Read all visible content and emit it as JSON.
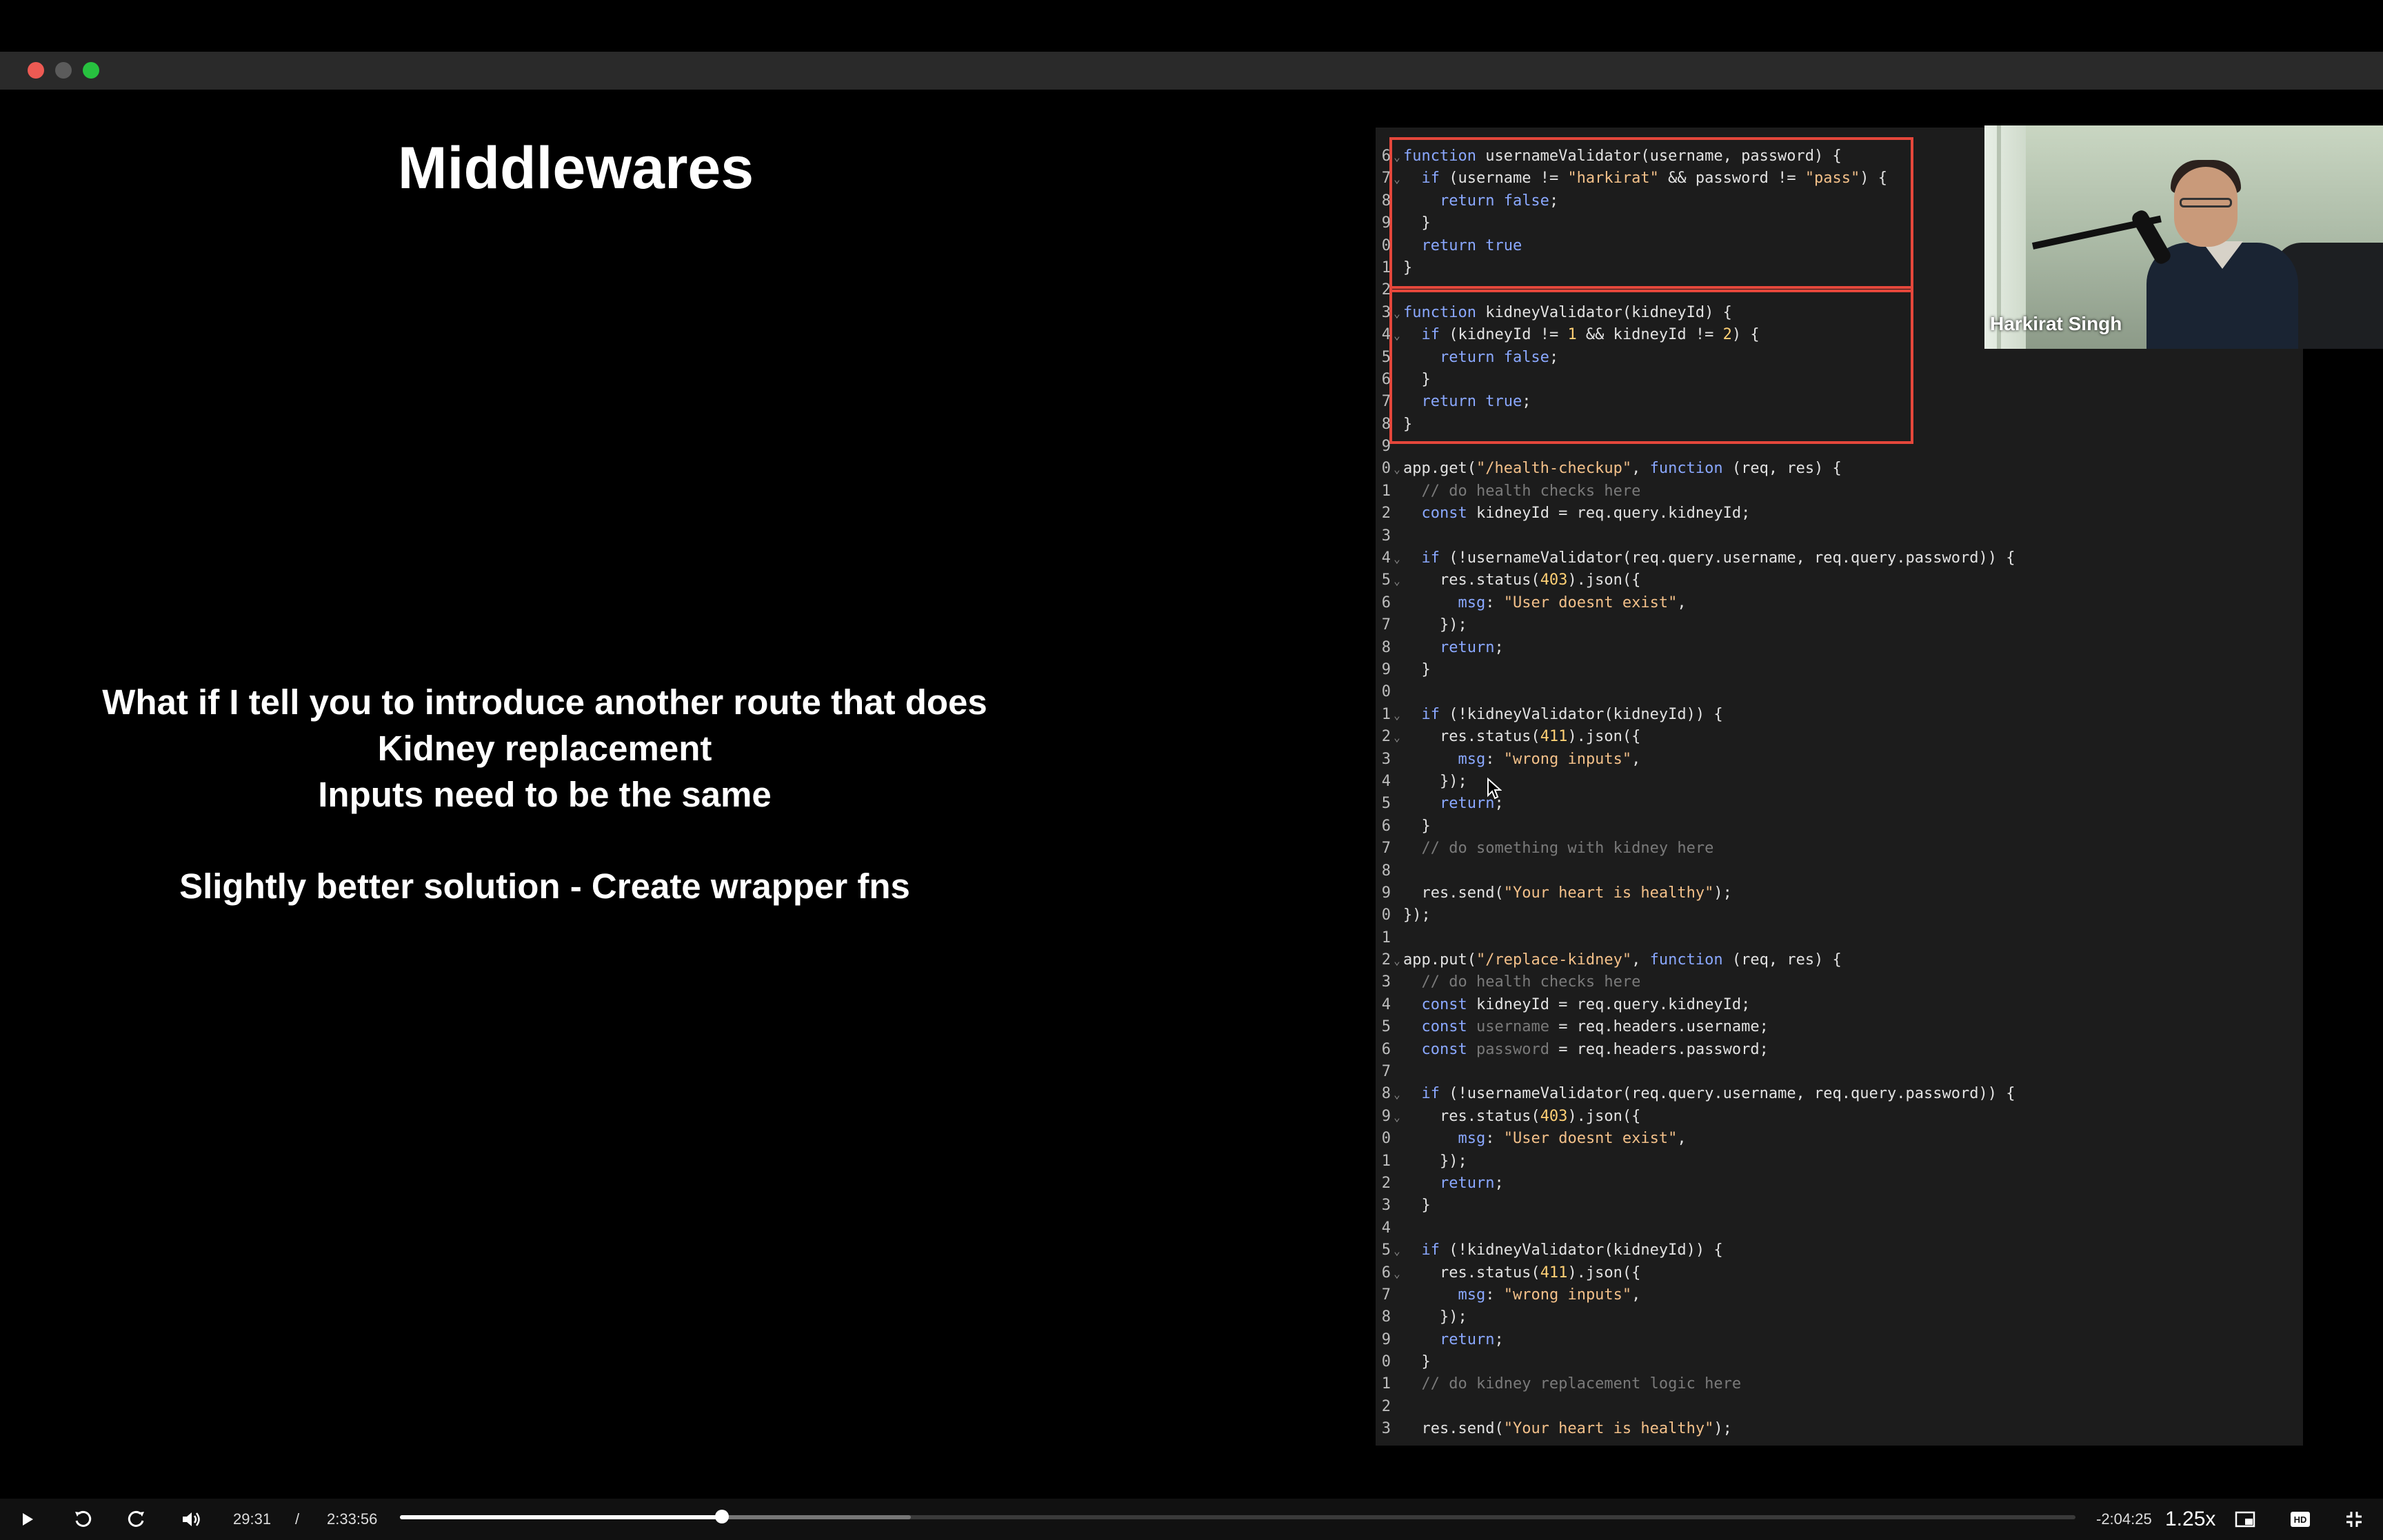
{
  "window": {
    "traffic_lights": [
      "close",
      "minimize",
      "maximize"
    ]
  },
  "slide": {
    "title": "Middlewares",
    "lines": [
      "What if I tell you to introduce another route that does",
      "Kidney replacement",
      "Inputs need to be the same",
      "",
      "Slightly better solution - Create wrapper fns"
    ]
  },
  "code": {
    "lines": [
      {
        "n": "6",
        "fold": true,
        "html": "<span class='kw'>function</span> usernameValidator(username, password) {"
      },
      {
        "n": "7",
        "fold": true,
        "html": "  <span class='kw'>if</span> (username != <span class='str'>\"harkirat\"</span> &amp;&amp; password != <span class='str'>\"pass\"</span>) {"
      },
      {
        "n": "8",
        "fold": false,
        "html": "    <span class='kw'>return false</span>;"
      },
      {
        "n": "9",
        "fold": false,
        "html": "  }"
      },
      {
        "n": "0",
        "fold": false,
        "html": "  <span class='kw'>return true</span>"
      },
      {
        "n": "1",
        "fold": false,
        "html": "}"
      },
      {
        "n": "2",
        "fold": false,
        "html": ""
      },
      {
        "n": "3",
        "fold": true,
        "html": "<span class='kw'>function</span> kidneyValidator(kidneyId) {"
      },
      {
        "n": "4",
        "fold": true,
        "html": "  <span class='kw'>if</span> (kidneyId != <span class='num'>1</span> &amp;&amp; kidneyId != <span class='num'>2</span>) {"
      },
      {
        "n": "5",
        "fold": false,
        "html": "    <span class='kw'>return false</span>;"
      },
      {
        "n": "6",
        "fold": false,
        "html": "  }"
      },
      {
        "n": "7",
        "fold": false,
        "html": "  <span class='kw'>return true</span>;"
      },
      {
        "n": "8",
        "fold": false,
        "html": "}"
      },
      {
        "n": "9",
        "fold": false,
        "html": ""
      },
      {
        "n": "0",
        "fold": true,
        "html": "app.get(<span class='str'>\"/health-checkup\"</span>, <span class='kw'>function</span> (req, res) {"
      },
      {
        "n": "1",
        "fold": false,
        "html": "  <span class='cm'>// do health checks here</span>"
      },
      {
        "n": "2",
        "fold": false,
        "html": "  <span class='kw'>const</span> kidneyId = req.query.kidneyId;"
      },
      {
        "n": "3",
        "fold": false,
        "html": ""
      },
      {
        "n": "4",
        "fold": true,
        "html": "  <span class='kw'>if</span> (!usernameValidator(req.query.username, req.query.password)) {"
      },
      {
        "n": "5",
        "fold": true,
        "html": "    res.status(<span class='num'>403</span>).json({"
      },
      {
        "n": "6",
        "fold": false,
        "html": "      <span class='kw'>msg</span>: <span class='str'>\"User doesnt exist\"</span>,"
      },
      {
        "n": "7",
        "fold": false,
        "html": "    });"
      },
      {
        "n": "8",
        "fold": false,
        "html": "    <span class='kw'>return</span>;"
      },
      {
        "n": "9",
        "fold": false,
        "html": "  }"
      },
      {
        "n": "0",
        "fold": false,
        "html": ""
      },
      {
        "n": "1",
        "fold": true,
        "html": "  <span class='kw'>if</span> (!kidneyValidator(kidneyId)) {"
      },
      {
        "n": "2",
        "fold": true,
        "html": "    res.status(<span class='num'>411</span>).json({"
      },
      {
        "n": "3",
        "fold": false,
        "html": "      <span class='kw'>msg</span>: <span class='str'>\"wrong inputs\"</span>,"
      },
      {
        "n": "4",
        "fold": false,
        "html": "    });"
      },
      {
        "n": "5",
        "fold": false,
        "html": "    <span class='kw'>return</span>;"
      },
      {
        "n": "6",
        "fold": false,
        "html": "  }"
      },
      {
        "n": "7",
        "fold": false,
        "html": "  <span class='cm'>// do something with kidney here</span>"
      },
      {
        "n": "8",
        "fold": false,
        "html": ""
      },
      {
        "n": "9",
        "fold": false,
        "html": "  res.send(<span class='str'>\"Your heart is healthy\"</span>);"
      },
      {
        "n": "0",
        "fold": false,
        "html": "});"
      },
      {
        "n": "1",
        "fold": false,
        "html": ""
      },
      {
        "n": "2",
        "fold": true,
        "html": "app.put(<span class='str'>\"/replace-kidney\"</span>, <span class='kw'>function</span> (req, res) {"
      },
      {
        "n": "3",
        "fold": false,
        "html": "  <span class='cm'>// do health checks here</span>"
      },
      {
        "n": "4",
        "fold": false,
        "html": "  <span class='kw'>const</span> kidneyId = req.query.kidneyId;"
      },
      {
        "n": "5",
        "fold": false,
        "html": "  <span class='kw'>const</span> <span class='cm'>username</span> = req.headers.username;"
      },
      {
        "n": "6",
        "fold": false,
        "html": "  <span class='kw'>const</span> <span class='cm'>password</span> = req.headers.password;"
      },
      {
        "n": "7",
        "fold": false,
        "html": ""
      },
      {
        "n": "8",
        "fold": true,
        "html": "  <span class='kw'>if</span> (!usernameValidator(req.query.username, req.query.password)) {"
      },
      {
        "n": "9",
        "fold": true,
        "html": "    res.status(<span class='num'>403</span>).json({"
      },
      {
        "n": "0",
        "fold": false,
        "html": "      <span class='kw'>msg</span>: <span class='str'>\"User doesnt exist\"</span>,"
      },
      {
        "n": "1",
        "fold": false,
        "html": "    });"
      },
      {
        "n": "2",
        "fold": false,
        "html": "    <span class='kw'>return</span>;"
      },
      {
        "n": "3",
        "fold": false,
        "html": "  }"
      },
      {
        "n": "4",
        "fold": false,
        "html": ""
      },
      {
        "n": "5",
        "fold": true,
        "html": "  <span class='kw'>if</span> (!kidneyValidator(kidneyId)) {"
      },
      {
        "n": "6",
        "fold": true,
        "html": "    res.status(<span class='num'>411</span>).json({"
      },
      {
        "n": "7",
        "fold": false,
        "html": "      <span class='kw'>msg</span>: <span class='str'>\"wrong inputs\"</span>,"
      },
      {
        "n": "8",
        "fold": false,
        "html": "    });"
      },
      {
        "n": "9",
        "fold": false,
        "html": "    <span class='kw'>return</span>;"
      },
      {
        "n": "0",
        "fold": false,
        "html": "  }"
      },
      {
        "n": "1",
        "fold": false,
        "html": "  <span class='cm'>// do kidney replacement logic here</span>"
      },
      {
        "n": "2",
        "fold": false,
        "html": ""
      },
      {
        "n": "3",
        "fold": false,
        "html": "  res.send(<span class='str'>\"Your heart is healthy\"</span>);"
      }
    ]
  },
  "webcam": {
    "name": "Harkirat Singh"
  },
  "player": {
    "current_time": "29:31",
    "separator": "/",
    "duration": "2:33:56",
    "remaining": "-2:04:25",
    "speed": "1.25x",
    "played_fraction": 0.192,
    "buffered_fraction": 0.305,
    "icons": [
      "play-icon",
      "rewind-icon",
      "forward-icon",
      "volume-icon",
      "pip-icon",
      "hd-icon",
      "exit-fullscreen-icon"
    ]
  },
  "colors": {
    "highlight_box": "#e5473b",
    "keyword": "#8aa8ff",
    "string": "#f3c089",
    "comment": "#7a7a7a"
  }
}
